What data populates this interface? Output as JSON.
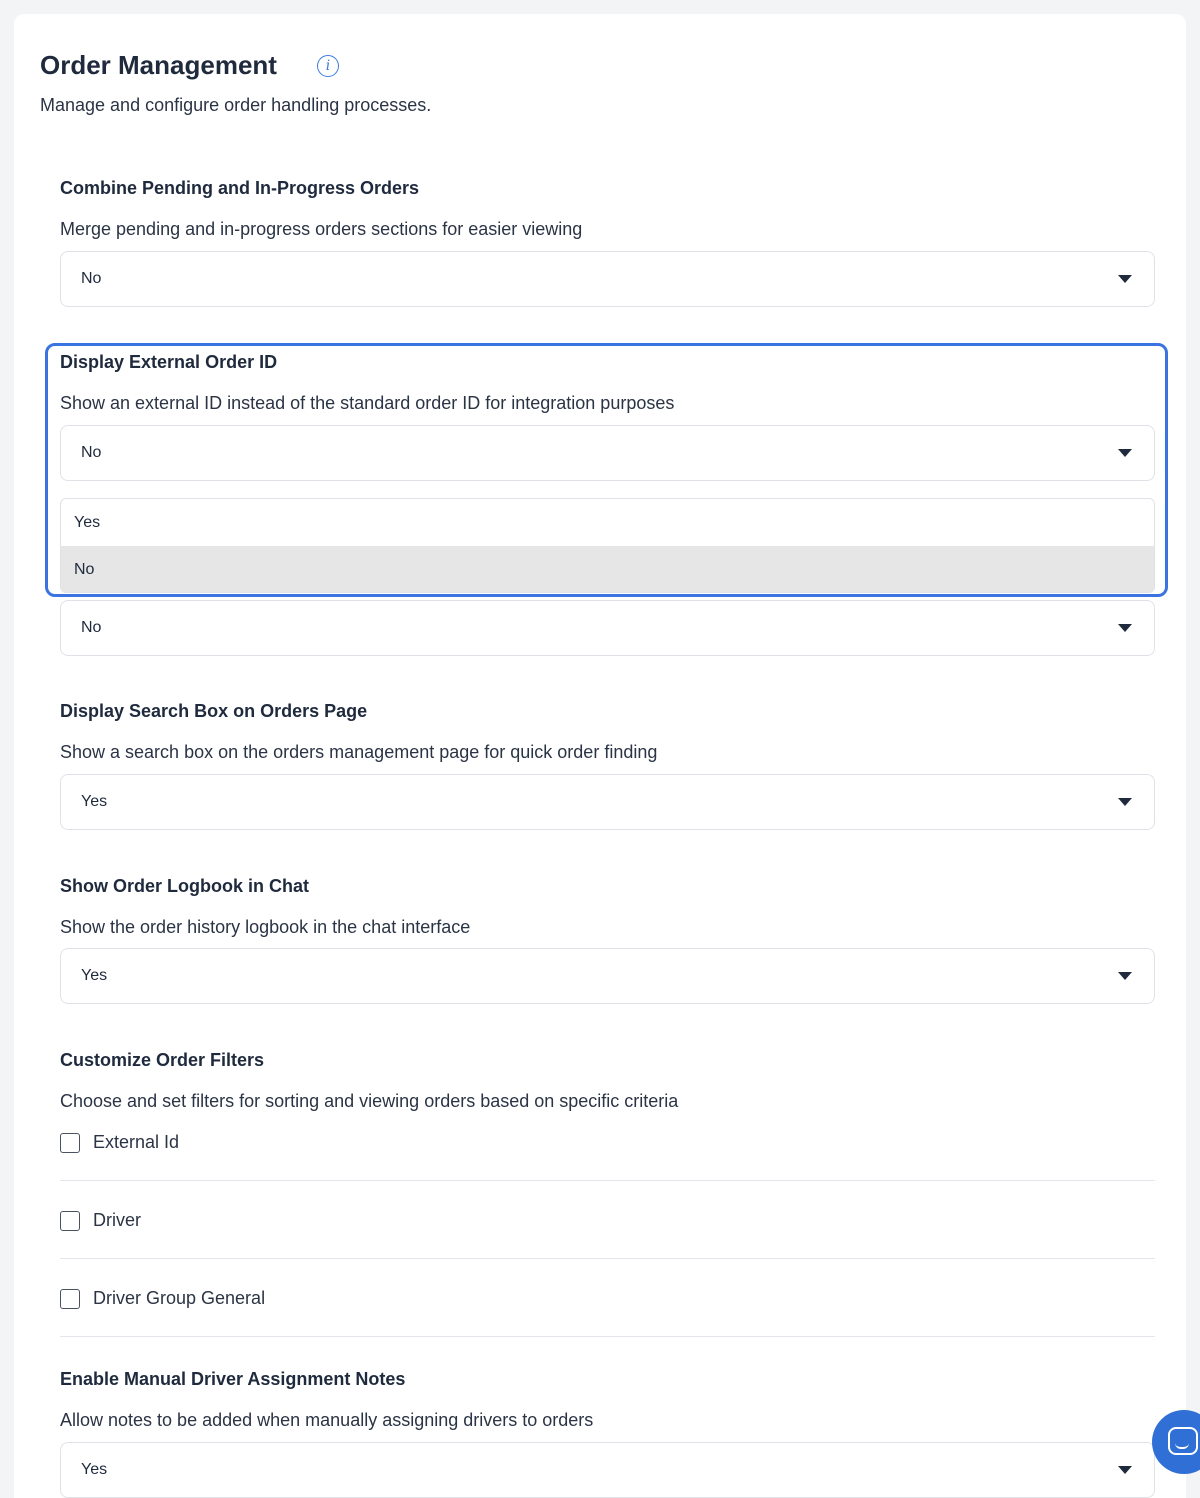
{
  "header": {
    "title": "Order Management",
    "info_icon": "info-icon",
    "subtitle": "Manage and configure order handling processes."
  },
  "settings": {
    "combine": {
      "title": "Combine Pending and In-Progress Orders",
      "description": "Merge pending and in-progress orders sections for easier viewing",
      "value": "No"
    },
    "external_id": {
      "title": "Display External Order ID",
      "description": "Show an external ID instead of the standard order ID for integration purposes",
      "value": "No",
      "options": [
        "Yes",
        "No"
      ],
      "selected_option": "No"
    },
    "hidden_setting": {
      "value": "No"
    },
    "search_box": {
      "title": "Display Search Box on Orders Page",
      "description": "Show a search box on the orders management page for quick order finding",
      "value": "Yes"
    },
    "logbook": {
      "title": "Show Order Logbook in Chat",
      "description": "Show the order history logbook in the chat interface",
      "value": "Yes"
    },
    "filters": {
      "title": "Customize Order Filters",
      "description": "Choose and set filters for sorting and viewing orders based on specific criteria",
      "options": [
        {
          "label": "External Id",
          "checked": false
        },
        {
          "label": "Driver",
          "checked": false
        },
        {
          "label": "Driver Group General",
          "checked": false
        }
      ]
    },
    "manual_notes": {
      "title": "Enable Manual Driver Assignment Notes",
      "description": "Allow notes to be added when manually assigning drivers to orders",
      "value": "Yes"
    }
  },
  "colors": {
    "accent": "#3b74e0",
    "text": "#1f2a3d",
    "border": "#dfe3e8",
    "selected_option_bg": "#e6e6e6"
  },
  "icons": {
    "dropdown": "caret-down-icon",
    "chat": "chat-icon"
  }
}
